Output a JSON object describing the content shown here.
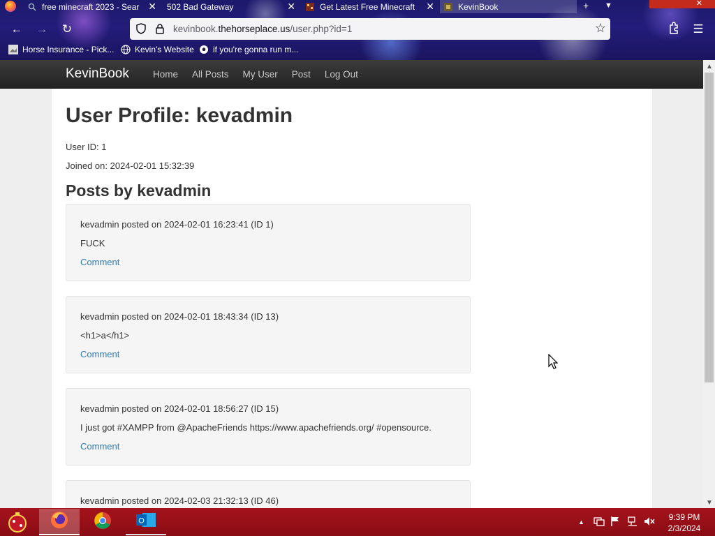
{
  "browser": {
    "tabs": [
      {
        "label": "free minecraft 2023 - Sear",
        "icon": "search-icon"
      },
      {
        "label": "502 Bad Gateway",
        "icon": "none"
      },
      {
        "label": "Get Latest Free Minecraft P",
        "icon": "minecraft-icon"
      },
      {
        "label": "KevinBook",
        "icon": "kevinbook-favicon"
      }
    ],
    "new_tab": "+",
    "url_domain_prefix": "kevinbook.",
    "url_domain_main": "thehorseplace.us",
    "url_path": "/user.php?id=1",
    "bookmarks": [
      {
        "label": "Horse Insurance - Pick..."
      },
      {
        "label": "Kevin's Website"
      },
      {
        "label": "if you're gonna run m..."
      }
    ]
  },
  "site": {
    "brand": "KevinBook",
    "nav": [
      "Home",
      "All Posts",
      "My User",
      "Post",
      "Log Out"
    ]
  },
  "profile": {
    "title": "User Profile: kevadmin",
    "user_id": "User ID: 1",
    "joined": "Joined on: 2024-02-01 15:32:39",
    "posts_heading": "Posts by kevadmin"
  },
  "posts": [
    {
      "header": "kevadmin posted on 2024-02-01 16:23:41 (ID 1)",
      "body": "FUCK",
      "link": "Comment"
    },
    {
      "header": "kevadmin posted on 2024-02-01 18:43:34 (ID 13)",
      "body": "<h1>a</h1>",
      "link": "Comment"
    },
    {
      "header": "kevadmin posted on 2024-02-01 18:56:27 (ID 15)",
      "body": "I just got #XAMPP from @ApacheFriends https://www.apachefriends.org/ #opensource.",
      "link": "Comment"
    },
    {
      "header": "kevadmin posted on 2024-02-03 21:32:13 (ID 46)",
      "body": "",
      "link": ""
    }
  ],
  "taskbar": {
    "apps": [
      "firefox-icon",
      "chrome-icon",
      "outlook-icon"
    ],
    "time": "9:39 PM",
    "date": "2/3/2024"
  },
  "colors": {
    "navbar": "#222222",
    "link": "#337ab7",
    "taskbar": "#a4131c"
  }
}
